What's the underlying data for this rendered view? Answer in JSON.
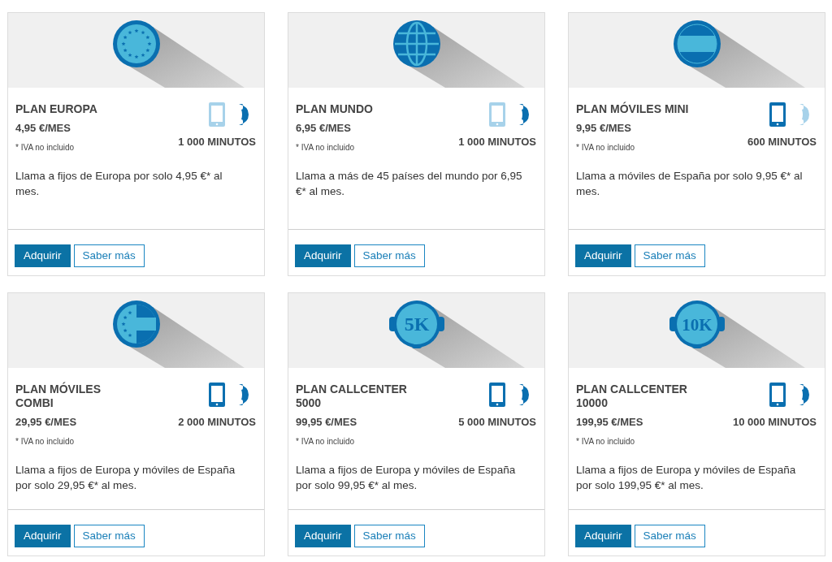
{
  "plans": [
    {
      "kind": "eu",
      "title": "PLAN EUROPA",
      "price": "4,95 €/MES",
      "tax_note": "* IVA no incluido",
      "mobile_included": false,
      "landline_included": true,
      "minutes": "1 000 MINUTOS",
      "description": "Llama a fijos de Europa por solo 4,95 €* al mes.",
      "buttons": [
        "Adquirir",
        "Saber más"
      ]
    },
    {
      "kind": "globe",
      "title": "PLAN MUNDO",
      "price": "6,95 €/MES",
      "tax_note": "* IVA no incluido",
      "mobile_included": false,
      "landline_included": true,
      "minutes": "1 000 MINUTOS",
      "description": "Llama a más de 45 países del mundo por 6,95 €* al mes.",
      "buttons": [
        "Adquirir",
        "Saber más"
      ]
    },
    {
      "kind": "stripes",
      "title": "PLAN MÓVILES MINI",
      "price": "9,95 €/MES",
      "tax_note": "* IVA no incluido",
      "mobile_included": true,
      "landline_included": false,
      "minutes": "600 MINUTOS",
      "description": "Llama a móviles de España por solo 9,95 €* al mes.",
      "buttons": [
        "Adquirir",
        "Saber más"
      ]
    },
    {
      "kind": "eu_stripes",
      "title": "PLAN MÓVILES COMBI",
      "price": "29,95 €/MES",
      "tax_note": "* IVA no incluido",
      "mobile_included": true,
      "landline_included": true,
      "minutes": "2 000 MINUTOS",
      "description": "Llama a fijos de Europa y móviles de España por solo 29,95 €* al mes.",
      "buttons": [
        "Adquirir",
        "Saber más"
      ]
    },
    {
      "kind": "headset",
      "emblem_text": "5K",
      "title": "PLAN CALLCENTER 5000",
      "price": "99,95 €/MES",
      "tax_note": "* IVA no incluido",
      "mobile_included": true,
      "landline_included": true,
      "minutes": "5 000 MINUTOS",
      "description": "Llama a fijos de Europa y móviles de España por solo 99,95 €* al mes.",
      "buttons": [
        "Adquirir",
        "Saber más"
      ]
    },
    {
      "kind": "headset",
      "emblem_text": "10K",
      "title": "PLAN CALLCENTER 10000",
      "price": "199,95 €/MES",
      "tax_note": "* IVA no incluido",
      "mobile_included": true,
      "landline_included": true,
      "minutes": "10 000 MINUTOS",
      "description": "Llama a fijos de Europa y móviles de España por solo 199,95 €* al mes.",
      "buttons": [
        "Adquirir",
        "Saber más"
      ]
    }
  ]
}
